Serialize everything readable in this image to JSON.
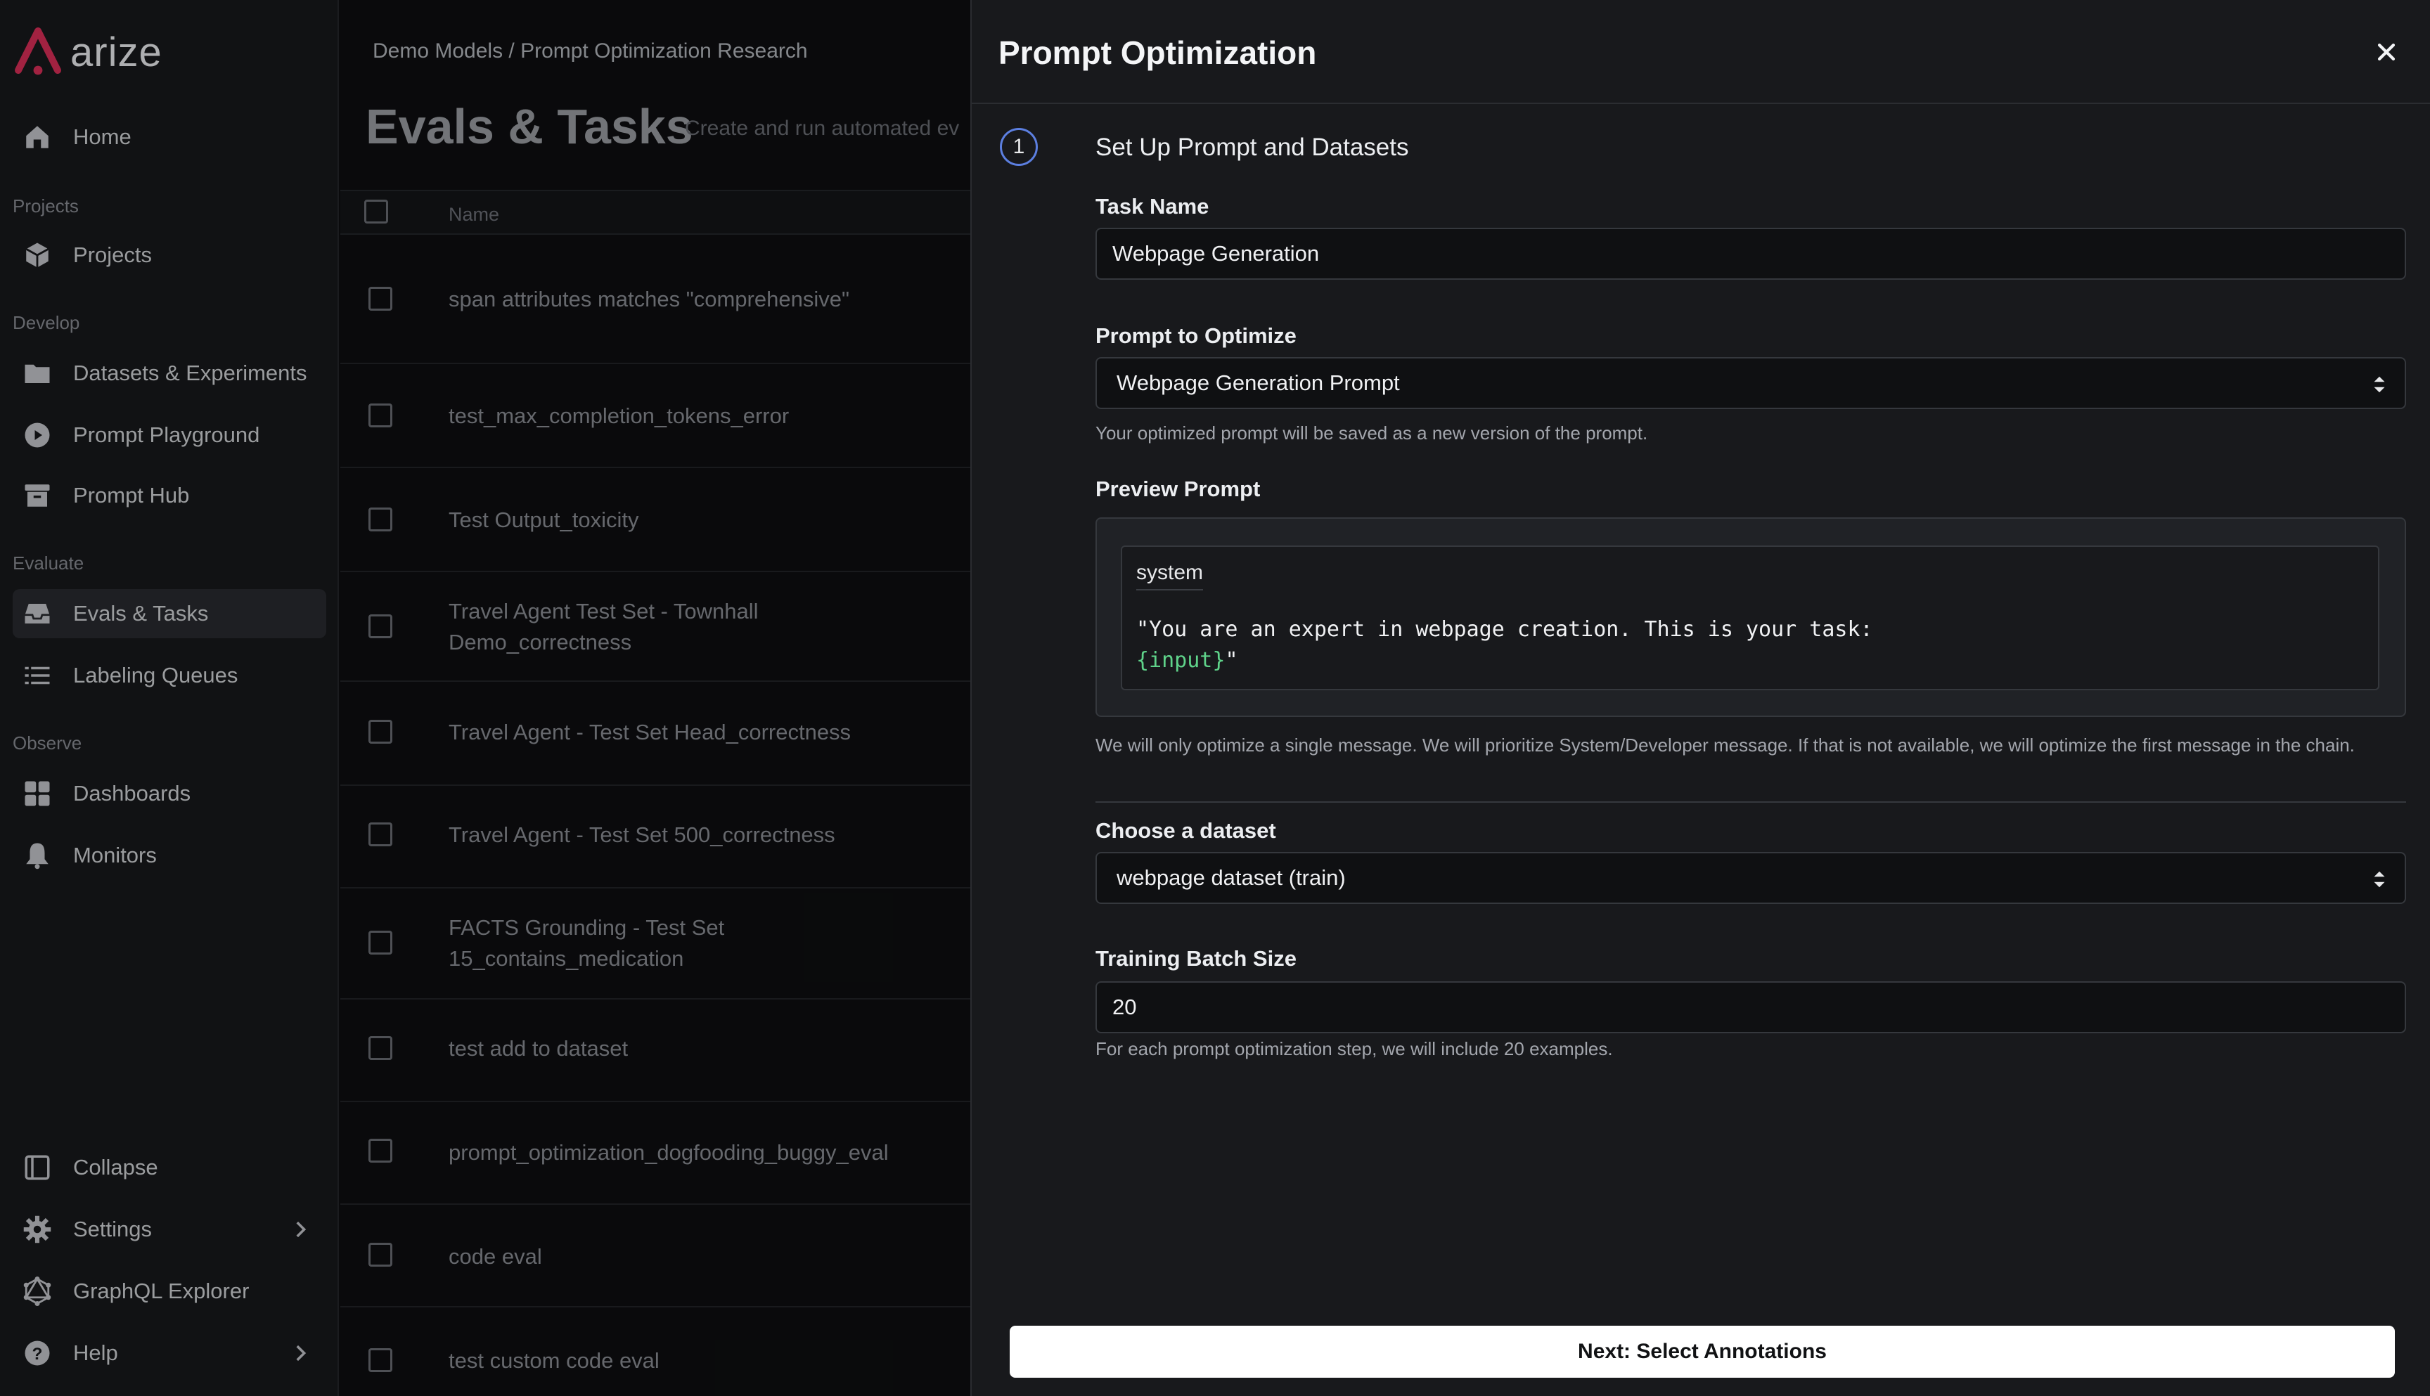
{
  "app": {
    "logo_text": "arize"
  },
  "sidebar": {
    "home": "Home",
    "section_projects": "Projects",
    "projects": "Projects",
    "section_develop": "Develop",
    "datasets": "Datasets & Experiments",
    "playground": "Prompt Playground",
    "hub": "Prompt Hub",
    "section_evaluate": "Evaluate",
    "evals": "Evals & Tasks",
    "labeling": "Labeling Queues",
    "section_observe": "Observe",
    "dashboards": "Dashboards",
    "monitors": "Monitors",
    "collapse": "Collapse",
    "settings": "Settings",
    "graphql": "GraphQL Explorer",
    "help": "Help"
  },
  "main": {
    "breadcrumb": "Demo Models / Prompt Optimization Research",
    "title": "Evals & Tasks",
    "subtitle": "Create and run automated ev",
    "column_name": "Name",
    "rows": [
      "span attributes matches \"comprehensive\"",
      "test_max_completion_tokens_error",
      "Test Output_toxicity",
      "Travel Agent Test Set - Townhall Demo_correctness",
      "Travel Agent - Test Set Head_correctness",
      "Travel Agent - Test Set 500_correctness",
      "FACTS Grounding - Test Set 15_contains_medication",
      "test add to dataset",
      "prompt_optimization_dogfooding_buggy_eval",
      "code eval",
      "test custom code eval"
    ]
  },
  "panel": {
    "title": "Prompt Optimization",
    "step_number": "1",
    "step_title": "Set Up Prompt and Datasets",
    "task_name_label": "Task Name",
    "task_name_value": "Webpage Generation",
    "prompt_label": "Prompt to Optimize",
    "prompt_value": "Webpage Generation Prompt",
    "prompt_help": "Your optimized prompt will be saved as a new version of the prompt.",
    "preview_label": "Preview Prompt",
    "preview_role": "system",
    "preview_line1": "\"You are an expert in webpage creation. This is your task:",
    "preview_var": "{input}",
    "preview_end": "\"",
    "single_message_help": "We will only optimize a single message. We will prioritize System/Developer message. If that is not available, we will optimize the first message in the chain.",
    "dataset_label": "Choose a dataset",
    "dataset_value": "webpage dataset (train)",
    "batch_label": "Training Batch Size",
    "batch_value": "20",
    "batch_help": "For each prompt optimization step, we will include 20 examples.",
    "next_button": "Next: Select Annotations"
  },
  "colors": {
    "accent": "#5c7fe0",
    "logo": "#e0305a",
    "variable": "#5fd38a"
  }
}
